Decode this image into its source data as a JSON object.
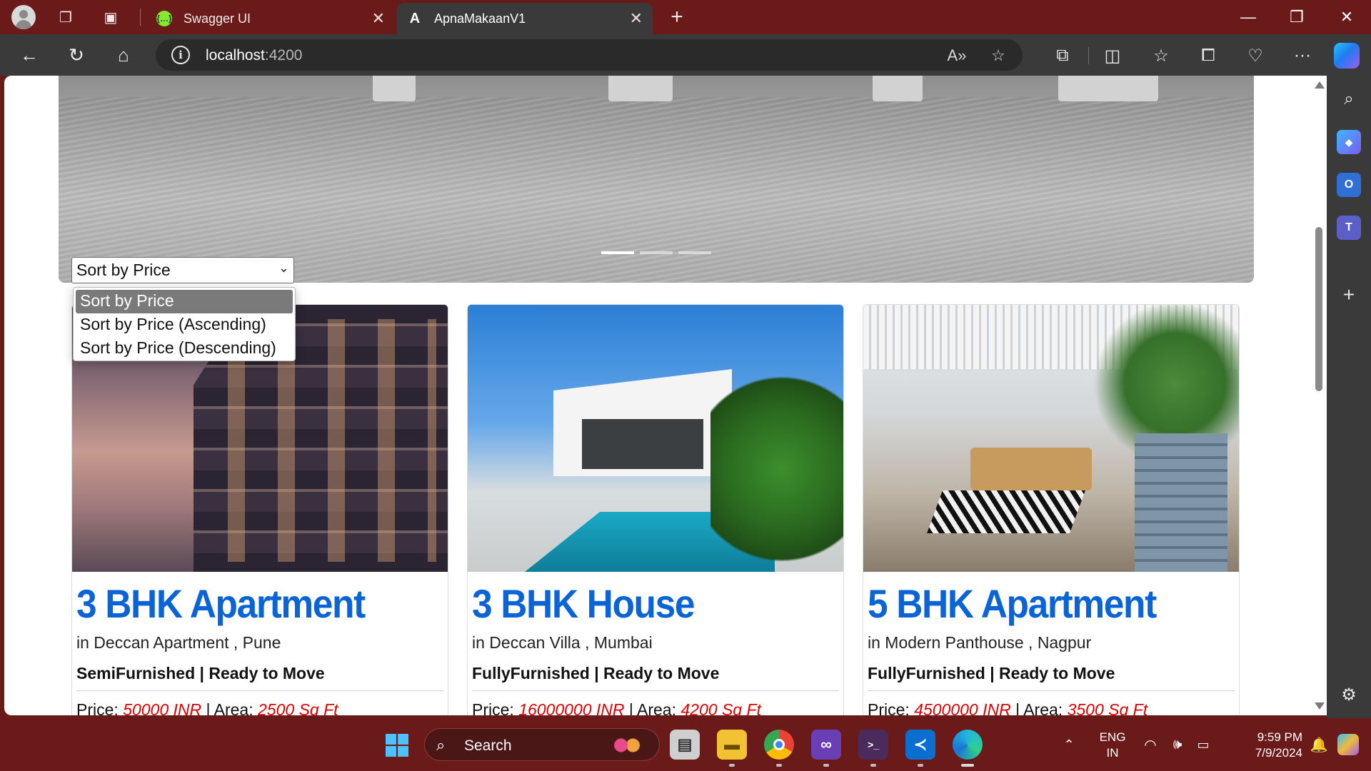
{
  "browser": {
    "tabs": [
      {
        "label": "Swagger UI",
        "favicon": "swagger-icon"
      },
      {
        "label": "ApnaMakaanV1",
        "favicon": "angular-icon"
      }
    ],
    "url_host": "localhost",
    "url_port": ":4200"
  },
  "page": {
    "sort": {
      "selected": "Sort by Price",
      "options": [
        "Sort by Price",
        "Sort by Price (Ascending)",
        "Sort by Price (Descending)"
      ]
    },
    "properties": [
      {
        "title": "3 BHK Apartment",
        "location": "in Deccan Apartment , Pune",
        "status": "SemiFurnished | Ready to Move",
        "price_label": "Price: ",
        "price": "50000 INR",
        "area_label": " | Area: ",
        "area": "2500 Sq Ft"
      },
      {
        "title": "3 BHK House",
        "location": "in Deccan Villa , Mumbai",
        "status": "FullyFurnished | Ready to Move",
        "price_label": "Price: ",
        "price": "16000000 INR",
        "area_label": " | Area: ",
        "area": "4200 Sq Ft"
      },
      {
        "title": "5 BHK Apartment",
        "location": "in Modern Panthouse , Nagpur",
        "status": "FullyFurnished | Ready to Move",
        "price_label": "Price: ",
        "price": "4500000 INR",
        "area_label": " | Area: ",
        "area": "3500 Sq Ft"
      }
    ],
    "carousel_active_index": 0,
    "carousel_count": 3
  },
  "taskbar": {
    "search_label": "Search",
    "lang_line1": "ENG",
    "lang_line2": "IN",
    "time": "9:59 PM",
    "date": "7/9/2024"
  },
  "colors": {
    "accent_title": "#0a64d6",
    "price_red": "#e00000",
    "frame": "#6b1a1a",
    "toolbar": "#3a3a3a"
  }
}
